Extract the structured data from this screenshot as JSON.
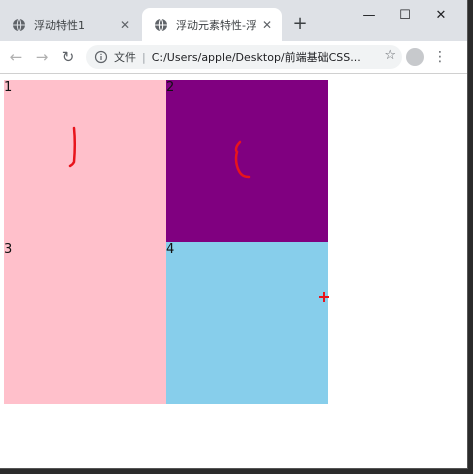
{
  "browser": {
    "tabs": [
      {
        "label": "浮动特性1",
        "active": false
      },
      {
        "label": "浮动元素特性-浮动",
        "active": true
      }
    ],
    "new_tab_label": "+",
    "window_controls": {
      "minimize": "—",
      "maximize": "☐",
      "close": "✕"
    },
    "toolbar": {
      "back": "←",
      "forward": "→",
      "reload": "↻",
      "address_label": "文件",
      "address_separator": "|",
      "url": "C:/Users/apple/Desktop/前端基础CSS...",
      "star": "☆",
      "menu": "⋮"
    }
  },
  "page": {
    "boxes": [
      {
        "label": "1",
        "color": "#ffc0cb"
      },
      {
        "label": "2",
        "color": "#800080"
      },
      {
        "label": "3",
        "color": "#ffc0cb"
      },
      {
        "label": "4",
        "color": "#87ceeb"
      }
    ]
  },
  "colors": {
    "annotation": "#e8141c",
    "tabstrip": "#dee1e6"
  },
  "icons": {
    "favicon": "globe-icon",
    "info": "info-icon",
    "profile": "avatar-icon"
  }
}
